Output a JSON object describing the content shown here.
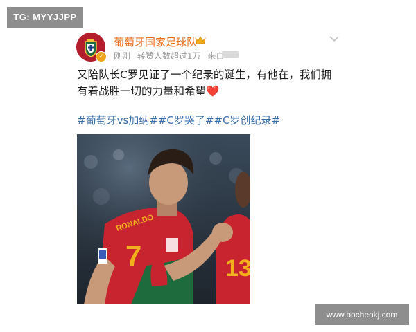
{
  "watermark_top": "TG: MYYJJPP",
  "watermark_bottom": "www.bochenkj.com",
  "post": {
    "author": "葡萄牙国家足球队",
    "meta_time": "刚刚",
    "meta_reposts": "转赞人数超过1万",
    "meta_source": "来自",
    "text_line1": "又陪队长C罗见证了一个纪录的诞生，有他在，我们拥",
    "text_line2": "有着战胜一切的力量和希望",
    "heart": "❤️",
    "tags": [
      "#葡萄牙vs加纳#",
      "#C罗哭了#",
      "#C罗创纪录#"
    ],
    "jersey_numbers": {
      "main": "7",
      "teammate": "13",
      "name_on_back": "RONALDO"
    }
  },
  "icons": [
    "portugal-crest-avatar",
    "verified-badge-icon",
    "crown-icon",
    "chevron-down-icon"
  ],
  "colors": {
    "author": "#e86e1c",
    "hashtag": "#3b6ea8",
    "meta": "#9a9a9a",
    "jersey_red": "#c8242f",
    "jersey_green": "#1e6b3e",
    "number_gold": "#f2b01e"
  }
}
